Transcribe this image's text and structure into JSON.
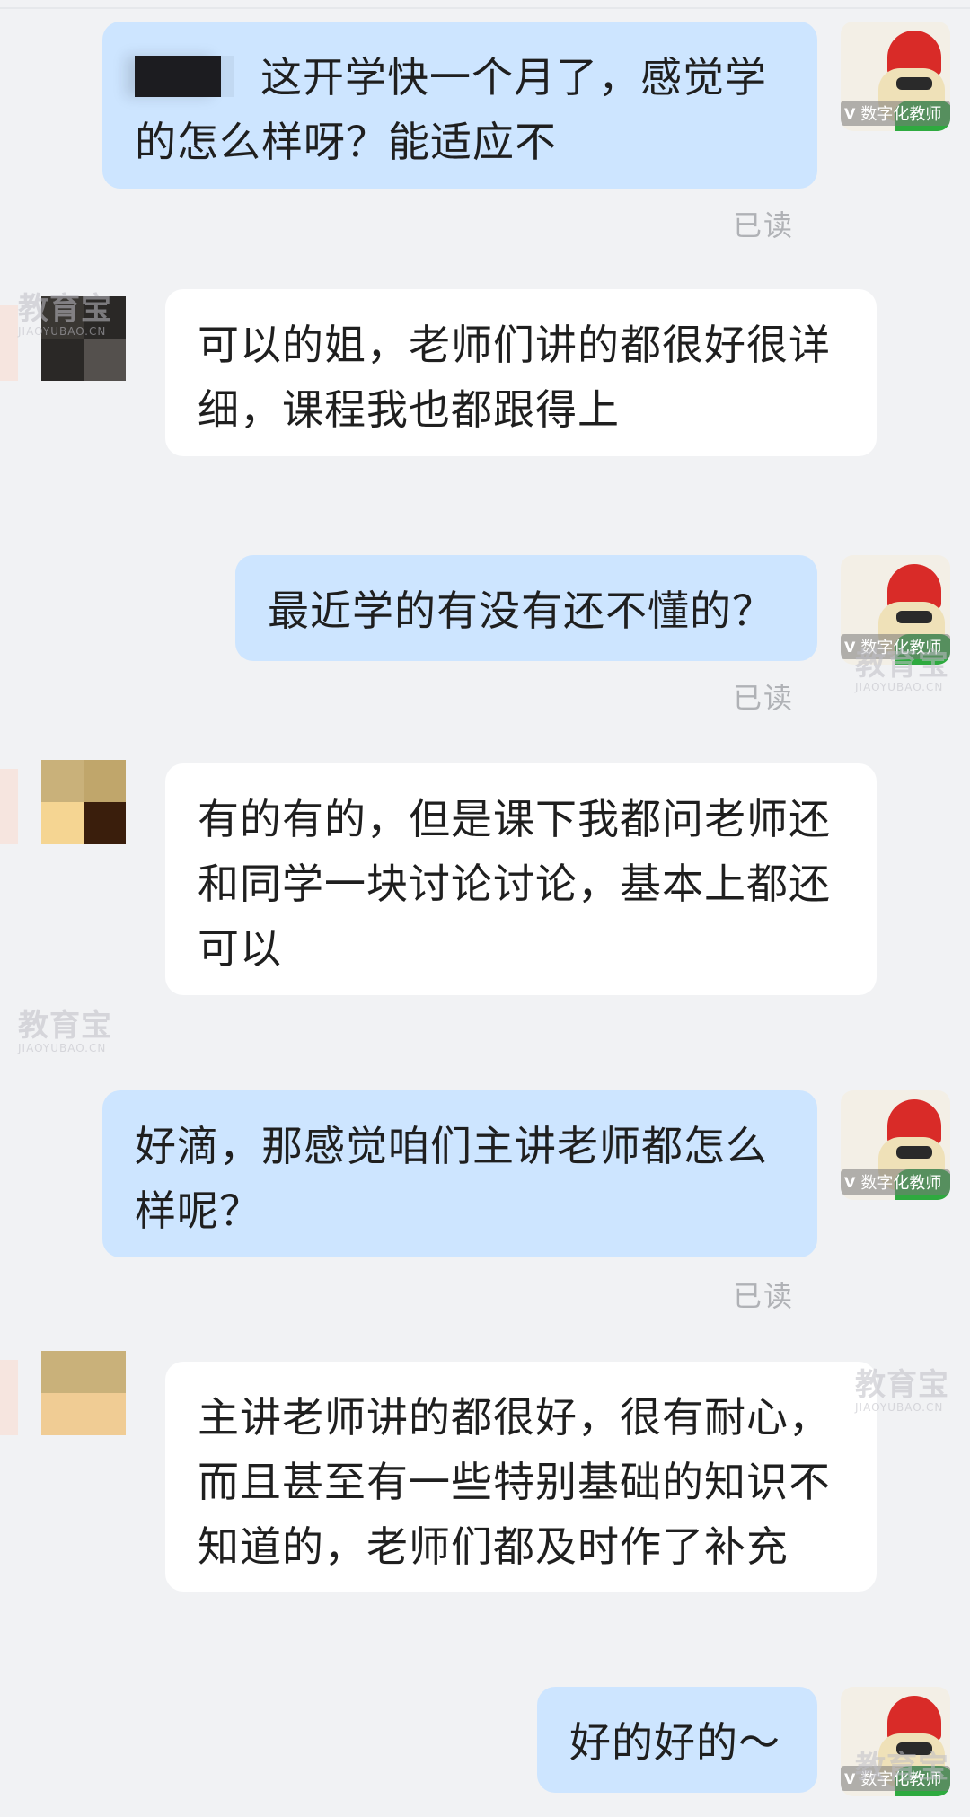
{
  "messages": [
    {
      "side": "out",
      "text": "这开学快一个月了，感觉学的怎么样呀？能适应不",
      "status": "已读"
    },
    {
      "side": "in",
      "text": "可以的姐，老师们讲的都很好很详细，课程我也都跟得上"
    },
    {
      "side": "out",
      "text": "最近学的有没有还不懂的？",
      "status": "已读"
    },
    {
      "side": "in",
      "text": "有的有的，但是课下我都问老师还和同学一块讨论讨论，基本上都还可以"
    },
    {
      "side": "out",
      "text": "好滴，那感觉咱们主讲老师都怎么样呢？",
      "status": "已读"
    },
    {
      "side": "in",
      "text": "主讲老师讲的都很好，很有耐心，而且甚至有一些特别基础的知识不知道的，老师们都及时作了补充"
    },
    {
      "side": "out",
      "text": "好的好的～"
    }
  ],
  "self_avatar": {
    "badge_vip": "V",
    "badge_text": "数字化教师"
  },
  "watermark": {
    "brand": "教育宝",
    "domain": "JIAOYUBAO.CN"
  },
  "colors": {
    "background": "#f1f2f4",
    "outgoing_bubble": "#cde5ff",
    "incoming_bubble": "#ffffff",
    "read_status": "#b0b2b6"
  },
  "icons": {
    "self_avatar": "avatar-icon",
    "contact_avatar": "blurred-avatar-icon"
  }
}
